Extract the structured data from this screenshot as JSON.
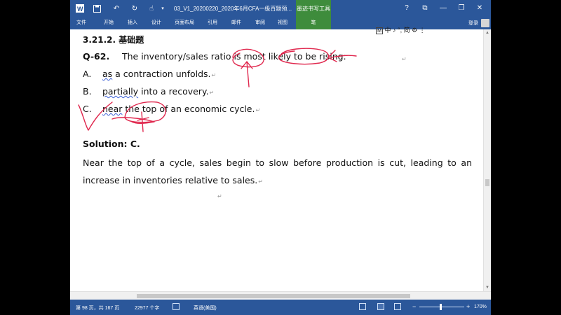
{
  "titlebar": {
    "doc_title": "03_V1_20200220_2020年6月CFA一级百题预...",
    "context_tab": "墨迹书写工具",
    "help": "?",
    "restore_ribbon": "⧉",
    "minimize": "—",
    "maximize": "❐",
    "close": "✕"
  },
  "tabs": {
    "file": "文件",
    "home": "开始",
    "insert": "插入",
    "design": "设计",
    "layout": "页面布局",
    "references": "引用",
    "mailings": "邮件",
    "review": "审阅",
    "view": "视图",
    "pen": "笔",
    "login": "登录"
  },
  "ime": {
    "box": "M",
    "text": "中 ♪ °, 简 ⚙ ⋮"
  },
  "document": {
    "heading": "3.21.2.  基础题",
    "question_num": "Q-62.",
    "question_text": "The inventory/sales ratio is most likely to be rising:",
    "options": [
      {
        "letter": "A.",
        "pre": "",
        "squig": "as",
        "post": " a contraction unfolds."
      },
      {
        "letter": "B.",
        "pre": "",
        "squig": "partially",
        "post": " into a recovery."
      },
      {
        "letter": "C.",
        "pre": "",
        "squig": "near",
        "post": " the top of an economic cycle."
      }
    ],
    "solution": "Solution: C.",
    "explanation": "Near the top of a cycle, sales begin to slow before production is cut, leading to an increase in inventories relative to sales.",
    "pilcrow": "↵"
  },
  "status": {
    "page": "第 98 页，共 167 页",
    "words": "22977 个字",
    "language": "英语(美国)",
    "zoom": "170%",
    "zoom_level_percent": 170
  },
  "colors": {
    "ribbon_blue": "#2b579a",
    "pen_green": "#3e8c3c",
    "ink_red": "#e0284e"
  }
}
